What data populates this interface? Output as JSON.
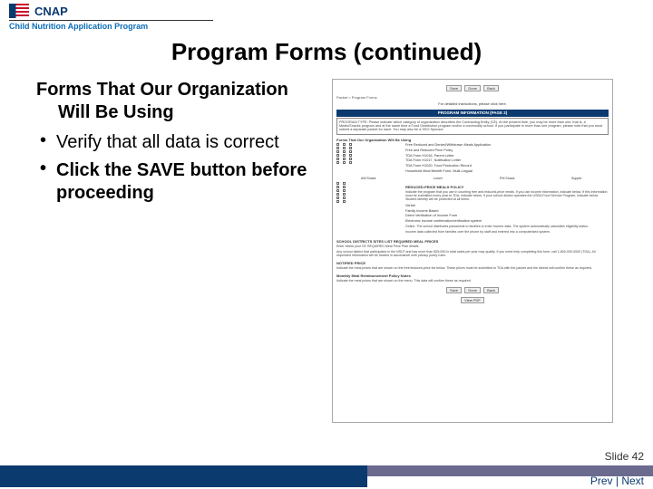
{
  "brand": {
    "name": "CNAP",
    "subtitle": "Child Nutrition Application Program"
  },
  "title": "Program Forms (continued)",
  "subheading": "Forms That Our Organization Will Be Using",
  "bullets": [
    "Verify that all data is correct",
    "Click the SAVE button before proceeding"
  ],
  "mock": {
    "buttons": {
      "save": "Save",
      "done": "Done",
      "back": "Back",
      "viewPdf": "View PDF"
    },
    "crumb": "Packet > Program Forms",
    "centerNote": "For detailed instructions, please click here.",
    "banner": "PROGRAM INFORMATION (PAGE 2)",
    "intro": "PROGRAM TYPE: Please indicate which category of organization describes the Contracting Entity (CE). At the present time, you may be more than one; that is, a Meals/Snacks program and at the same time a Food Distribution program and/or a commodity school. If you participate in more than one program, please note that you must submit a separate packet for each. You may also be a SSO Sponsor.",
    "sectionA_title": "Forms That Our Organization Will Be Using",
    "sectionA_items": [
      "Free Reduced and Denied/Withdrawn Meals Application",
      "Free and Reduced Price Policy",
      "TDA Form H1016, Parent Letter",
      "TDA Form H1017, Notification Letter",
      "TDA Form H1020, Food Production Record",
      "Household Meal Benefit Form, Multi-Lingual"
    ],
    "col_heads": [
      "AM Snack",
      "Lunch",
      "PM Snack",
      "Supper"
    ],
    "sectionB_title": "REDUCED-PRICE MEALS POLICY",
    "sectionB_intro": "Indicate the program that you use in counting free and reduced-price meals. If you use income information, indicate below. If this information must be submitted every year to TDA, indicate below. If your school district operates the USDA Food Service Program, indicate below. Student identity will be protected at all times.",
    "sectionB_items": [
      "Verbal",
      "Family Income Based",
      "Direct Verification of Income Form",
      "Electronic income confirmation/verification system",
      "Online. The school distributes passwords to families to enter income data. The system automatically calculates eligibility status.",
      "Income data collected from families over the phone by staff and entered into a computerized system."
    ],
    "sectionC_title": "SCHOOL DISTRICTS SITES LIST REQUIRED MEAL PRICES",
    "sectionC_sub": "Enter below your CE REQUIRED Meal Price Plan details.",
    "sectionC_text": "Any school district that participates in the NSLP and has more than $25,000 in total sales per year may qualify. If you need help completing this form, call 1-800-000-0000 (TDA). All requested information will be treated in accordance with privacy policy rules.",
    "sectionD_title": "NOTIFIED PRICE",
    "sectionD_text": "Indicate the meal prices that are shown on the free/reduced-price list below. These prices must be submitted to TDA with the packet and the district will confirm these as required.",
    "sectionE_title": "Monthly Meal Reimbursement Policy Notes",
    "sectionE_text": "Indicate the meal prices that are shown on the menu. This data will confirm these as required."
  },
  "footer": {
    "slide_label": "Slide 42",
    "prev": "Prev",
    "sep": " | ",
    "next": "Next"
  }
}
